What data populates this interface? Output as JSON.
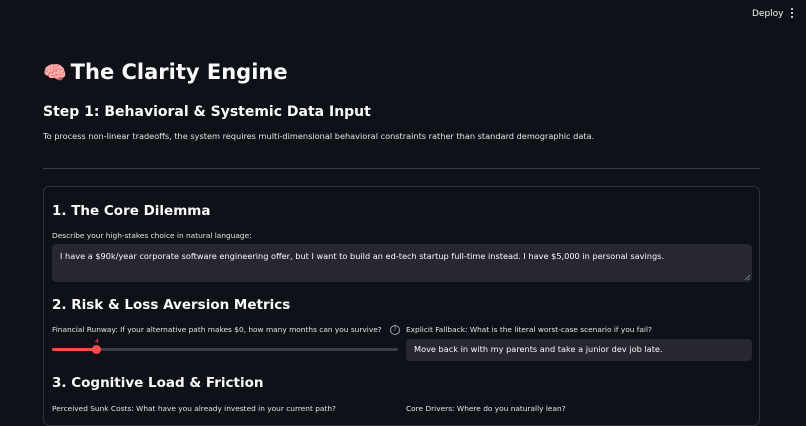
{
  "header": {
    "deploy_label": "Deploy",
    "menu_icon": "kebab-menu-icon"
  },
  "page": {
    "title_icon": "🧠",
    "title": "The Clarity Engine",
    "subtitle": "Step 1: Behavioral & Systemic Data Input",
    "description": "To process non-linear tradeoffs, the system requires multi-dimensional behavioral constraints rather than standard demographic data."
  },
  "sections": {
    "core_dilemma": {
      "heading": "1. The Core Dilemma",
      "label": "Describe your high-stakes choice in natural language:",
      "value": "I have a $90k/year corporate software engineering offer, but I want to build an ed-tech startup full-time instead. I have $5,000 in personal savings."
    },
    "risk": {
      "heading": "2. Risk & Loss Aversion Metrics",
      "runway_label": "Financial Runway: If your alternative path makes $0, how many months can you survive?",
      "runway_value": "4",
      "runway_fraction": 0.13,
      "help_icon": "help-circle-icon",
      "fallback_label": "Explicit Fallback: What is the literal worst-case scenario if you fail?",
      "fallback_value": "Move back in with my parents and take a junior dev job late."
    },
    "cognitive": {
      "heading": "3. Cognitive Load & Friction",
      "sunk_costs_label": "Perceived Sunk Costs: What have you already invested in your current path?",
      "core_drivers_label": "Core Drivers: Where do you naturally lean?"
    }
  },
  "colors": {
    "accent": "#ff4b4b",
    "background": "#0e1117",
    "input_bg": "#262730"
  }
}
